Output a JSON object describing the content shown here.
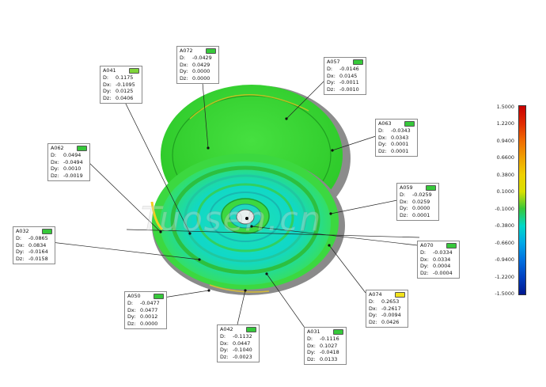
{
  "watermark": "Tuosen.cn",
  "callouts": [
    {
      "id": "A072",
      "color": "#36c83a",
      "rows": [
        [
          "D:",
          "-0.0429"
        ],
        [
          "Dx:",
          "0.0429"
        ],
        [
          "Dy:",
          "0.0000"
        ],
        [
          "Dz:",
          "0.0000"
        ]
      ]
    },
    {
      "id": "A041",
      "color": "#7fd43a",
      "rows": [
        [
          "D:",
          "0.1175"
        ],
        [
          "Dx:",
          "-0.1095"
        ],
        [
          "Dy:",
          "0.0125"
        ],
        [
          "Dz:",
          "0.0406"
        ]
      ]
    },
    {
      "id": "A057",
      "color": "#36c83a",
      "rows": [
        [
          "D:",
          "-0.0146"
        ],
        [
          "Dx:",
          "0.0145"
        ],
        [
          "Dy:",
          "-0.0011"
        ],
        [
          "Dz:",
          "-0.0010"
        ]
      ]
    },
    {
      "id": "A063",
      "color": "#36c83a",
      "rows": [
        [
          "D:",
          "-0.0343"
        ],
        [
          "Dx:",
          "0.0343"
        ],
        [
          "Dy:",
          "0.0001"
        ],
        [
          "Dz:",
          "0.0001"
        ]
      ]
    },
    {
      "id": "A062",
      "color": "#36c83a",
      "rows": [
        [
          "D:",
          "0.0494"
        ],
        [
          "Dx:",
          "-0.0494"
        ],
        [
          "Dy:",
          "0.0010"
        ],
        [
          "Dz:",
          "-0.0019"
        ]
      ]
    },
    {
      "id": "A059",
      "color": "#36c83a",
      "rows": [
        [
          "D:",
          "-0.0259"
        ],
        [
          "Dx:",
          "0.0259"
        ],
        [
          "Dy:",
          "0.0000"
        ],
        [
          "Dz:",
          "0.0001"
        ]
      ]
    },
    {
      "id": "A032",
      "color": "#36c83a",
      "rows": [
        [
          "D:",
          "-0.0865"
        ],
        [
          "Dx:",
          "0.0834"
        ],
        [
          "Dy:",
          "-0.0164"
        ],
        [
          "Dz:",
          "-0.0158"
        ]
      ]
    },
    {
      "id": "A070",
      "color": "#36c83a",
      "rows": [
        [
          "D:",
          "-0.0334"
        ],
        [
          "Dx:",
          "0.0334"
        ],
        [
          "Dy:",
          "0.0004"
        ],
        [
          "Dz:",
          "-0.0004"
        ]
      ]
    },
    {
      "id": "A050",
      "color": "#36c83a",
      "rows": [
        [
          "D:",
          "-0.0477"
        ],
        [
          "Dx:",
          "0.0477"
        ],
        [
          "Dy:",
          "0.0012"
        ],
        [
          "Dz:",
          "0.0000"
        ]
      ]
    },
    {
      "id": "A074",
      "color": "#f2e21c",
      "rows": [
        [
          "D:",
          "0.2653"
        ],
        [
          "Dx:",
          "-0.2617"
        ],
        [
          "Dy:",
          "-0.0094"
        ],
        [
          "Dz:",
          "0.0426"
        ]
      ]
    },
    {
      "id": "A042",
      "color": "#36c83a",
      "rows": [
        [
          "D:",
          "-0.1132"
        ],
        [
          "Dx:",
          "0.0447"
        ],
        [
          "Dy:",
          "-0.1040"
        ],
        [
          "Dz:",
          "-0.0023"
        ]
      ]
    },
    {
      "id": "A031",
      "color": "#36c83a",
      "rows": [
        [
          "D:",
          "-0.1116"
        ],
        [
          "Dx:",
          "0.1027"
        ],
        [
          "Dy:",
          "-0.0418"
        ],
        [
          "Dz:",
          "0.0133"
        ]
      ]
    }
  ],
  "legend": {
    "labels": [
      "1.5000",
      "1.2200",
      "0.9400",
      "0.6600",
      "0.3800",
      "0.1000",
      "-0.1000",
      "-0.3800",
      "-0.6600",
      "-0.9400",
      "-1.2200",
      "-1.5000"
    ],
    "colors": [
      "#c80000",
      "#e02a00",
      "#f06a00",
      "#f0a000",
      "#f0d000",
      "#d8e000",
      "#36c83a",
      "#00d8c8",
      "#00a8e8",
      "#0070e0",
      "#0040c0",
      "#001890"
    ]
  }
}
